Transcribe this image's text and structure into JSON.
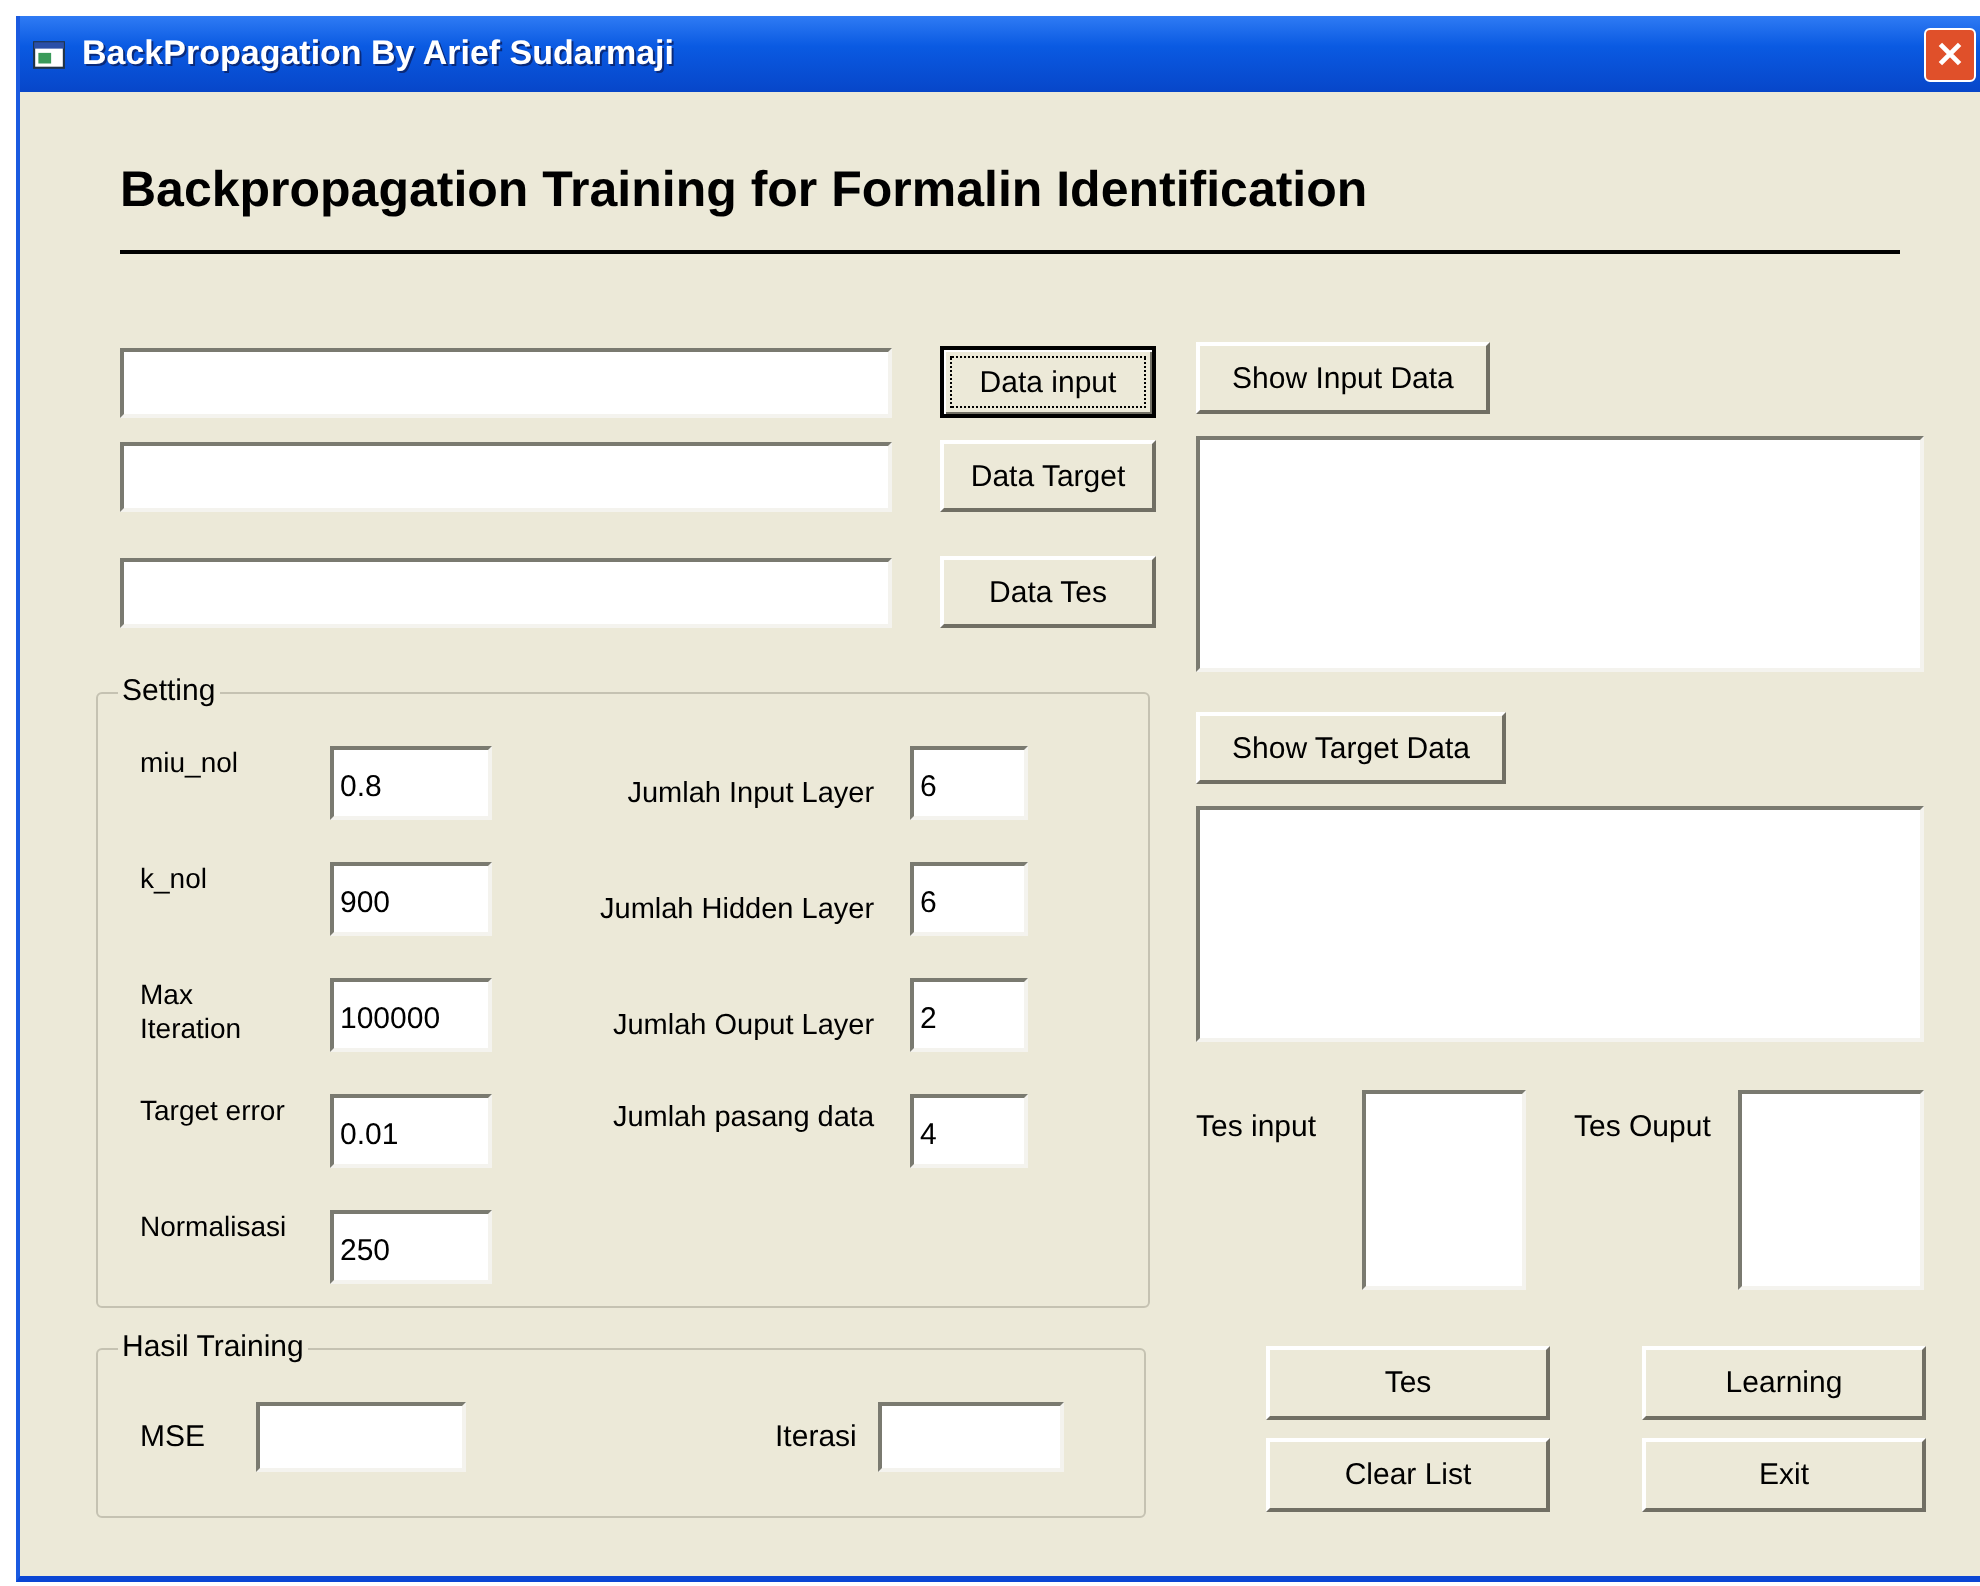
{
  "window": {
    "title": "BackPropagation By Arief Sudarmaji"
  },
  "heading": "Backpropagation Training for Formalin Identification",
  "file_rows": [
    {
      "button": "Data input",
      "focused": true
    },
    {
      "button": "Data Target",
      "focused": false
    },
    {
      "button": "Data Tes",
      "focused": false
    }
  ],
  "setting": {
    "title": "Setting",
    "left_fields": [
      {
        "label": "miu_nol",
        "value": "0.8"
      },
      {
        "label": "k_nol",
        "value": "900"
      },
      {
        "label": "Max Iteration",
        "value": "100000"
      },
      {
        "label": "Target error",
        "value": "0.01"
      },
      {
        "label": "Normalisasi",
        "value": "250"
      }
    ],
    "right_fields": [
      {
        "label": "Jumlah Input Layer",
        "value": "6"
      },
      {
        "label": "Jumlah Hidden Layer",
        "value": "6"
      },
      {
        "label": "Jumlah Ouput Layer",
        "value": "2"
      },
      {
        "label": "Jumlah pasang data",
        "value": "4"
      }
    ]
  },
  "hasil_training": {
    "title": "Hasil Training",
    "fields": [
      {
        "label": "MSE"
      },
      {
        "label": "Iterasi"
      }
    ]
  },
  "show_input_button": "Show Input Data",
  "show_target_button": "Show Target Data",
  "tes_input_label": "Tes input",
  "tes_output_label": "Tes Ouput",
  "action_buttons": [
    "Tes",
    "Learning",
    "Clear List",
    "Exit"
  ]
}
